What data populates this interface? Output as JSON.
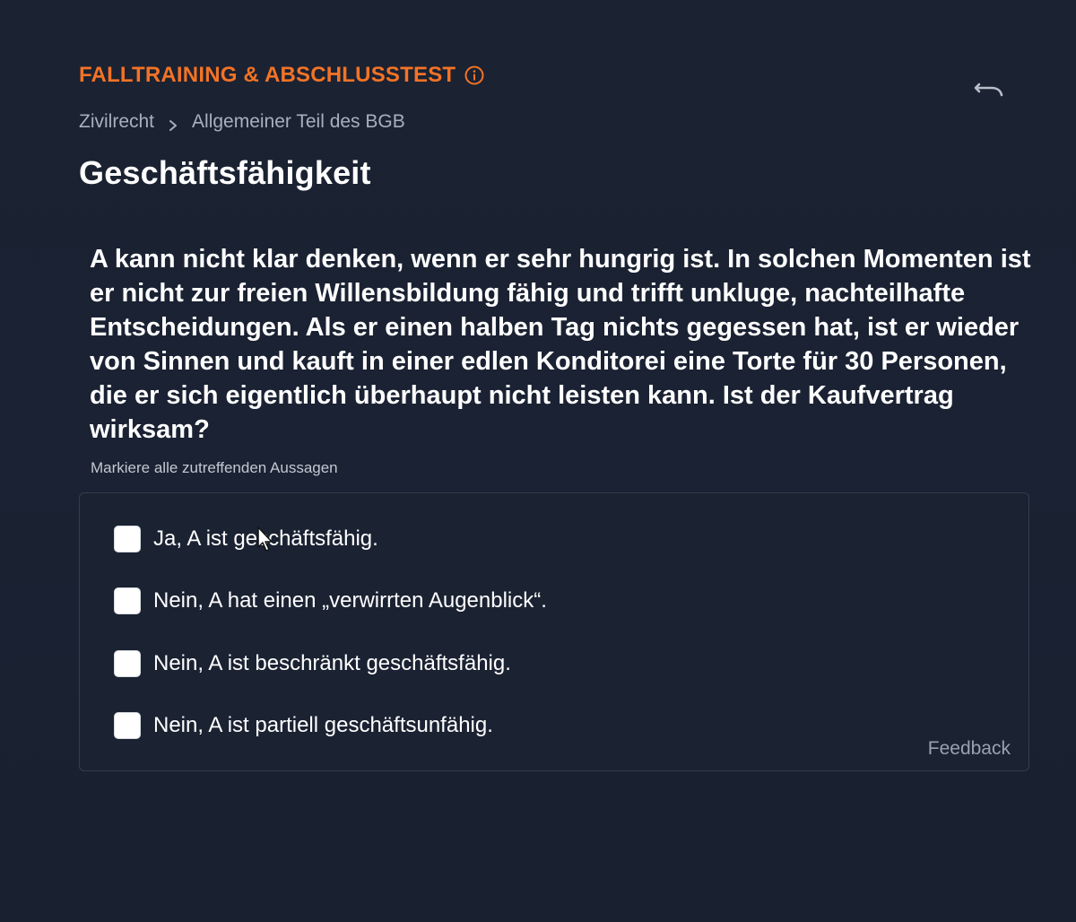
{
  "header": {
    "section_label": "FALLTRAINING & ABSCHLUSSTEST"
  },
  "breadcrumb": {
    "items": [
      "Zivilrecht",
      "Allgemeiner Teil des BGB"
    ]
  },
  "page_title": "Geschäftsfähigkeit",
  "question": {
    "text": "A kann nicht klar denken, wenn er sehr hungrig ist. In solchen Momenten ist er nicht zur freien Willensbildung fähig und trifft unkluge, nachteilhafte Entscheidungen. Als er einen halben Tag nichts gegessen hat, ist er wieder von Sinnen und kauft in einer edlen Konditorei eine Torte für 30 Personen, die er sich eigentlich überhaupt nicht leisten kann. Ist der Kaufvertrag wirksam?",
    "instruction": "Markiere alle zutreffenden Aussagen"
  },
  "options": [
    {
      "label": "Ja, A ist geschäftsfähig.",
      "checked": false
    },
    {
      "label": "Nein, A hat einen „verwirrten Augenblick“.",
      "checked": false
    },
    {
      "label": "Nein, A ist beschränkt geschäftsfähig.",
      "checked": false
    },
    {
      "label": "Nein, A ist partiell geschäftsunfähig.",
      "checked": false
    }
  ],
  "feedback_label": "Feedback",
  "icons": {
    "info": "info-icon",
    "undo": "undo-icon",
    "chevron": "chevron-right-icon",
    "cursor": "mouse-cursor-icon"
  },
  "colors": {
    "accent": "#f37325",
    "background": "#1b2232",
    "muted_text": "#a8b0bd"
  }
}
